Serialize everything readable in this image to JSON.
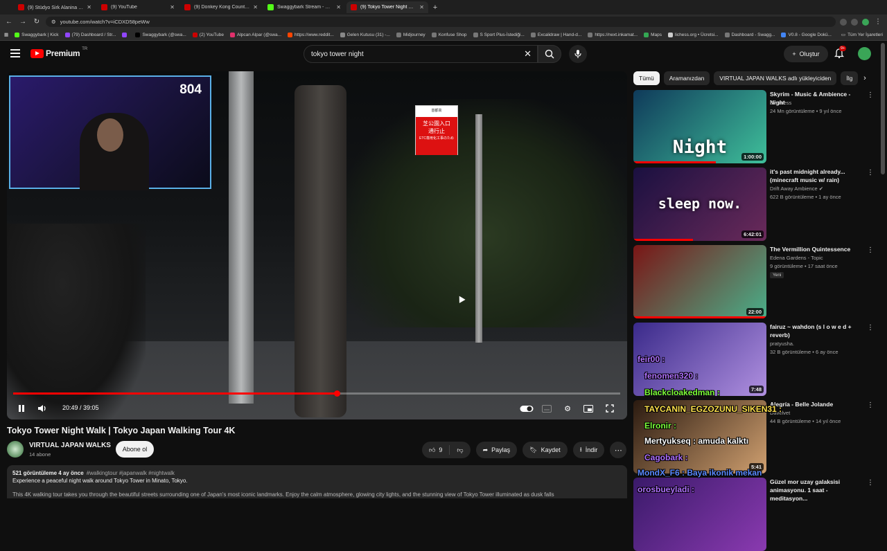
{
  "browser": {
    "tabs": [
      {
        "label": "(9) Stüdyo Sirk Alanina Döndü 🎪",
        "color": "#cc0000",
        "active": false
      },
      {
        "label": "(9) YouTube",
        "color": "#cc0000",
        "active": false
      },
      {
        "label": "(9) Donkey Kong Country -",
        "color": "#cc0000",
        "active": false
      },
      {
        "label": "Swaggybark Stream - Watch Li",
        "color": "#53fc18",
        "active": false
      },
      {
        "label": "(9) Tokyo Tower Night Walk",
        "color": "#cc0000",
        "active": true
      }
    ],
    "url": "youtube.com/watch?v=iCDXD58peWw",
    "bookmarks": [
      "Swaggybark | Kick",
      "(79) Dashboard / Str...",
      "",
      "Swaggybark (@swa...",
      "(2) YouTube",
      "Alpcan Alpar (@swa...",
      "https://www.reddit...",
      "Gelen Kutusu (31) -...",
      "Midjourney",
      "Konfuse Shop",
      "S Sport Plus-İstediği...",
      "Excalidraw | Hand-d...",
      "https://next.inkamat...",
      "Maps",
      "lichess.org • Ücretsi...",
      "Dashboard - Swagg...",
      "V0.8 - Google Dokü..."
    ],
    "bookmarks_right": "Tüm Yer İşaretleri"
  },
  "header": {
    "logo_text": "Premium",
    "logo_sup": "TR",
    "search_value": "tokyo tower night",
    "create_label": "Oluştur",
    "notif_badge": "9+"
  },
  "player": {
    "overlay_count": "804",
    "time": "20:49 / 39:05",
    "progress": 0.533,
    "sign_top": "芝公園入口",
    "sign_main_1": "芝公園入口",
    "sign_main_2": "通行止",
    "sign_main_3": "ETC専用化工事のため"
  },
  "video": {
    "title": "Tokyo Tower Night Walk | Tokyo Japan Walking Tour 4K",
    "channel": "VIRTUAL JAPAN WALKS",
    "subs": "14 abone",
    "subscribe_label": "Abone ol",
    "likes": "9",
    "share_label": "Paylaş",
    "save_label": "Kaydet",
    "download_label": "İndir",
    "desc_meta": "521 görüntüleme  4 ay önce",
    "desc_tags": "#walkingtour #japanwalk #nightwalk",
    "desc_line1": "Experience a peaceful night walk around Tokyo Tower in Minato, Tokyo.",
    "desc_line2": "This 4K walking tour takes you through the beautiful streets surrounding one of Japan's most iconic landmarks. Enjoy the calm atmosphere, glowing city lights, and the stunning view of Tokyo Tower illuminated as dusk falls"
  },
  "chips": [
    "Tümü",
    "Aramanızdan",
    "VIRTUAL JAPAN WALKS adlı yükleyiciden",
    "İlg"
  ],
  "recs": [
    {
      "title": "Skyrim - Music & Ambience - Night",
      "channel": "Everness",
      "views": "24 Mn görüntüleme • 9 yıl önce",
      "duration": "1:00:00",
      "thumb_text": "Night",
      "colors": [
        "#0f3a5a",
        "#3fbf9a"
      ]
    },
    {
      "title": "it's past midnight already... (minecraft music w/ rain)",
      "channel": "Drift Away Ambience ✔",
      "views": "622 B görüntüleme • 1 ay önce",
      "duration": "6:42:01",
      "thumb_text": "sleep now.",
      "colors": [
        "#1a1040",
        "#6a2a5a"
      ]
    },
    {
      "title": "The Vermillion Quintessence",
      "channel": "Edena Gardens - Topic",
      "views": "9 görüntüleme • 17 saat önce",
      "duration": "22:00",
      "badge": "Yeni",
      "thumb_text": "",
      "colors": [
        "#7a1515",
        "#4ab08a"
      ]
    },
    {
      "title": "fairuz ~ wahdon (s l o w e d + reverb)",
      "channel": "pratyusha.",
      "views": "32 B görüntüleme • 6 ay önce",
      "duration": "7:48",
      "thumb_text": "",
      "colors": [
        "#3a2a8a",
        "#b090e0"
      ]
    },
    {
      "title": "Alegría - Belle Jolande",
      "channel": "Davelvet",
      "views": "44 B görüntüleme • 14 yıl önce",
      "duration": "5:41",
      "thumb_text": "",
      "colors": [
        "#2a1a10",
        "#d0a070"
      ]
    },
    {
      "title": "Güzel mor uzay galaksisi animasyonu. 1 saat - meditasyon...",
      "channel": "",
      "views": "",
      "duration": "",
      "thumb_text": "",
      "colors": [
        "#3a1a6a",
        "#8a3ab0"
      ]
    }
  ],
  "chat": [
    {
      "text": "feir00 :",
      "color": "#b070ff"
    },
    {
      "text": "fenomen320 :",
      "color": "#b070ff"
    },
    {
      "text": "Blackcloakedman :",
      "color": "#7dff3a"
    },
    {
      "text": "TAYCANIN_EGZOZUNU_SIKEN31 :",
      "color": "#ffe14d"
    },
    {
      "text": "Elronir :",
      "color": "#7dff3a"
    },
    {
      "text": "Mertyukseq : amuda kalktı",
      "color": "#ffffff"
    },
    {
      "text": "Cagobark :",
      "color": "#b070ff"
    },
    {
      "text": "MondX_F6 : Baya ikonik mekan",
      "color": "#5a8aff"
    },
    {
      "text": "orosbueyladi :",
      "color": "#b070ff"
    }
  ]
}
